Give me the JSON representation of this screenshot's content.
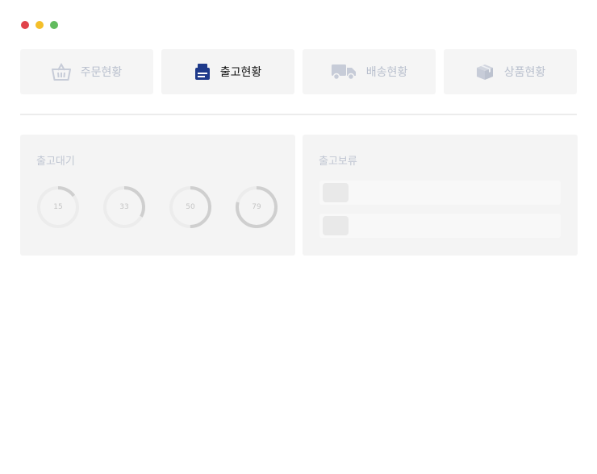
{
  "window": {
    "controls": [
      {
        "name": "close",
        "color": "#e0434a"
      },
      {
        "name": "minimize",
        "color": "#f4bf2a"
      },
      {
        "name": "maximize",
        "color": "#62bb5e"
      }
    ]
  },
  "tabs": [
    {
      "label": "주문현황",
      "icon": "basket-icon",
      "active": false
    },
    {
      "label": "출고현황",
      "icon": "printer-icon",
      "active": true
    },
    {
      "label": "배송현황",
      "icon": "truck-icon",
      "active": false
    },
    {
      "label": "상품현황",
      "icon": "box-icon",
      "active": false
    }
  ],
  "panels": {
    "waiting": {
      "title": "출고대기",
      "gauges": [
        {
          "value": "15",
          "percent": 15
        },
        {
          "value": "33",
          "percent": 33
        },
        {
          "value": "50",
          "percent": 50
        },
        {
          "value": "79",
          "percent": 79
        }
      ]
    },
    "hold": {
      "title": "출고보류",
      "rows": 2
    }
  },
  "colors": {
    "accent": "#1e3a8a",
    "inactive_icon": "#c7ccd8",
    "gauge_track": "#ececec",
    "gauge_fill": "#cfcfcf"
  }
}
